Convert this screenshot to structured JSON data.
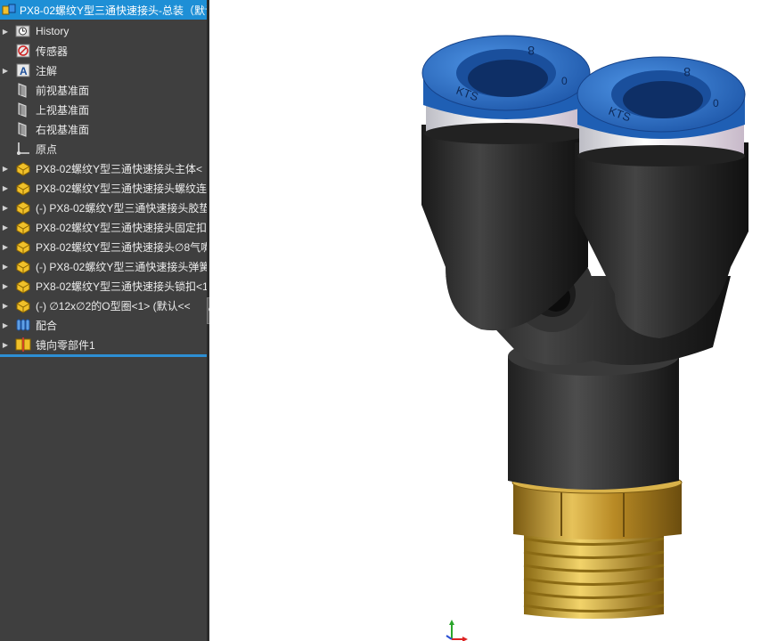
{
  "tree": {
    "title": "PX8-02螺纹Y型三通快速接头-总装（默认",
    "items": [
      {
        "label": "History",
        "icon": "history-icon",
        "expandable": true
      },
      {
        "label": "传感器",
        "icon": "sensor-icon",
        "expandable": false
      },
      {
        "label": "注解",
        "icon": "annotation-icon",
        "expandable": true
      },
      {
        "label": "前视基准面",
        "icon": "plane-icon",
        "expandable": false
      },
      {
        "label": "上视基准面",
        "icon": "plane-icon",
        "expandable": false
      },
      {
        "label": "右视基准面",
        "icon": "plane-icon",
        "expandable": false
      },
      {
        "label": "原点",
        "icon": "origin-icon",
        "expandable": false
      },
      {
        "label": "PX8-02螺纹Y型三通快速接头主体<",
        "icon": "part-icon",
        "expandable": true
      },
      {
        "label": "PX8-02螺纹Y型三通快速接头螺纹连接",
        "icon": "part-icon",
        "expandable": true
      },
      {
        "label": "(-) PX8-02螺纹Y型三通快速接头胶垫",
        "icon": "part-icon",
        "expandable": true
      },
      {
        "label": "PX8-02螺纹Y型三通快速接头固定扣<",
        "icon": "part-icon",
        "expandable": true
      },
      {
        "label": "PX8-02螺纹Y型三通快速接头∅8气嘴<",
        "icon": "part-icon",
        "expandable": true
      },
      {
        "label": "(-) PX8-02螺纹Y型三通快速接头弹簧",
        "icon": "part-icon",
        "expandable": true
      },
      {
        "label": "PX8-02螺纹Y型三通快速接头锁扣<1>",
        "icon": "part-icon",
        "expandable": true
      },
      {
        "label": "(-) ∅12x∅2的O型圈<1> (默认<<",
        "icon": "part-icon",
        "expandable": true
      },
      {
        "label": "配合",
        "icon": "mates-icon",
        "expandable": true
      },
      {
        "label": "镜向零部件1",
        "icon": "mirror-component-icon",
        "expandable": true
      }
    ]
  },
  "model": {
    "cap_marking_left": "KTS",
    "cap_marking_digit_left": "8",
    "cap_marking_zero_left": "0",
    "cap_marking_right": "KTS",
    "cap_marking_digit_right": "8",
    "cap_marking_zero_right": "0"
  },
  "colors": {
    "tree_bg": "#3f3f3f",
    "header_bg": "#1e8fd6",
    "cap_blue": "#2f73c8",
    "body_black": "#2a2a2a",
    "brass": "#c9a13a"
  }
}
